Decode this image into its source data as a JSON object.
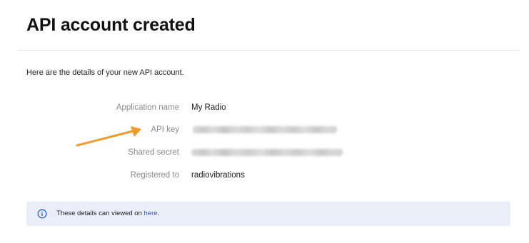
{
  "page": {
    "title": "API account created",
    "intro": "Here are the details of your new API account."
  },
  "details": [
    {
      "label": "Application name",
      "value": "My Radio",
      "blurred": false
    },
    {
      "label": "API key",
      "value": "",
      "blurred": true
    },
    {
      "label": "Shared secret",
      "value": "",
      "blurred": true
    },
    {
      "label": "Registered to",
      "value": "radiovibrations",
      "blurred": false
    }
  ],
  "notice": {
    "text": "These details can viewed on",
    "link_label": "here",
    "suffix": ".",
    "icon": "info-circle-icon"
  },
  "annotation": {
    "icon": "arrow-right-icon",
    "color": "#f39a2a"
  },
  "colors": {
    "notice_bg": "#e9eef9",
    "link": "#2a62c9",
    "label": "#8a8a8a"
  }
}
